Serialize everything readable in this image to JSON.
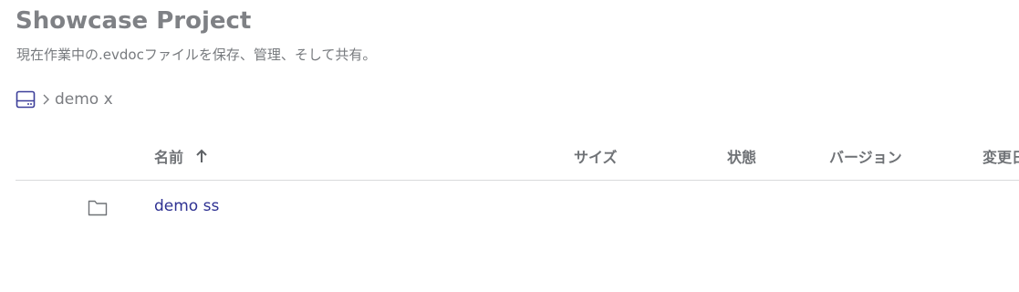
{
  "project": {
    "title": "Showcase Project",
    "subtitle": "現在作業中の.evdocファイルを保存、管理、そして共有。"
  },
  "breadcrumb": {
    "root_icon": "drive-icon",
    "separator_icon": "chevron-right-icon",
    "current": "demo x"
  },
  "table": {
    "columns": {
      "name": "名前",
      "size": "サイズ",
      "state": "状態",
      "version": "バージョン",
      "modified": "変更日"
    },
    "sort": {
      "column": "name",
      "direction": "ascending",
      "icon": "arrow-up-icon"
    },
    "rows": [
      {
        "icon": "folder-icon",
        "name": "demo ss"
      }
    ]
  },
  "colors": {
    "title": "#7f8185",
    "link": "#2e3192",
    "icon_accent": "#3d3f9a",
    "divider": "#d9dadc"
  }
}
